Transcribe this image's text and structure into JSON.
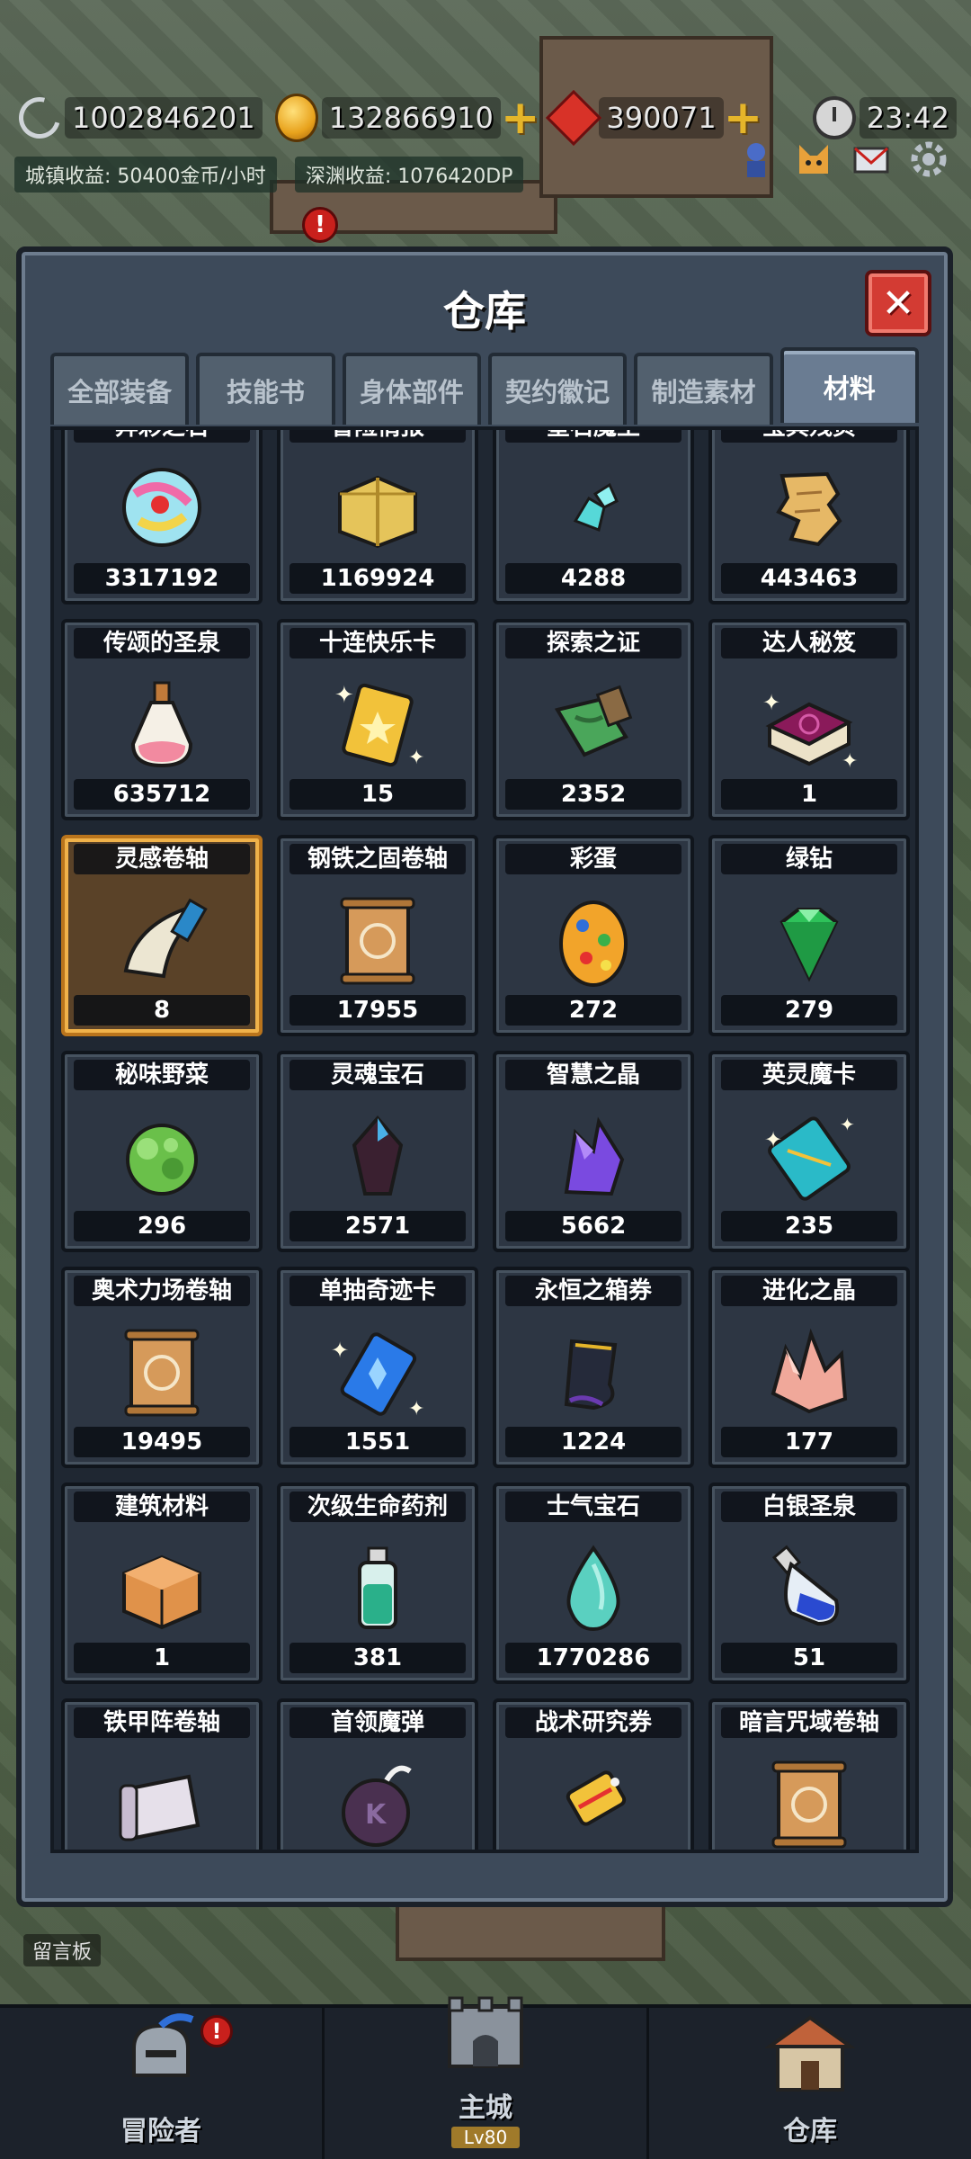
{
  "hud": {
    "moon_value": "1002846201",
    "gold_value": "132866910",
    "gem_value": "390071",
    "time": "23:42",
    "town_income": "城镇收益: 50400金币/小时",
    "abyss_income": "深渊收益: 1076420DP"
  },
  "panel": {
    "title": "仓库",
    "close_label": "✕"
  },
  "tabs": [
    {
      "label": "全部装备",
      "active": false
    },
    {
      "label": "技能书",
      "active": false
    },
    {
      "label": "身体部件",
      "active": false
    },
    {
      "label": "契约徽记",
      "active": false
    },
    {
      "label": "制造素材",
      "active": false
    },
    {
      "label": "材料",
      "active": true
    }
  ],
  "items": [
    {
      "name": "异彩之石",
      "count": "3317192",
      "icon": "rainbow-orb"
    },
    {
      "name": "冒险情报",
      "count": "1169924",
      "icon": "parcel"
    },
    {
      "name": "星石魔土",
      "count": "4288",
      "icon": "cyan-ore"
    },
    {
      "name": "宝典残页",
      "count": "443463",
      "icon": "torn-page"
    },
    {
      "name": "传颂的圣泉",
      "count": "635712",
      "icon": "potion-bottle"
    },
    {
      "name": "十连快乐卡",
      "count": "15",
      "icon": "gold-card"
    },
    {
      "name": "探索之证",
      "count": "2352",
      "icon": "map-scroll"
    },
    {
      "name": "达人秘笈",
      "count": "1",
      "icon": "purple-book"
    },
    {
      "name": "灵感卷轴",
      "count": "8",
      "icon": "horn-scroll",
      "selected": true
    },
    {
      "name": "钢铁之固卷轴",
      "count": "17955",
      "icon": "brown-scroll"
    },
    {
      "name": "彩蛋",
      "count": "272",
      "icon": "easter-egg"
    },
    {
      "name": "绿钻",
      "count": "279",
      "icon": "green-gem"
    },
    {
      "name": "秘味野菜",
      "count": "296",
      "icon": "green-herb"
    },
    {
      "name": "灵魂宝石",
      "count": "2571",
      "icon": "dark-crystal"
    },
    {
      "name": "智慧之晶",
      "count": "5662",
      "icon": "purple-crystal"
    },
    {
      "name": "英灵魔卡",
      "count": "235",
      "icon": "teal-card"
    },
    {
      "name": "奥术力场卷轴",
      "count": "19495",
      "icon": "brown-scroll"
    },
    {
      "name": "单抽奇迹卡",
      "count": "1551",
      "icon": "blue-card"
    },
    {
      "name": "永恒之箱券",
      "count": "1224",
      "icon": "dark-ticket"
    },
    {
      "name": "进化之晶",
      "count": "177",
      "icon": "pink-crystal"
    },
    {
      "name": "建筑材料",
      "count": "1",
      "icon": "brick-block"
    },
    {
      "name": "次级生命药剂",
      "count": "381",
      "icon": "green-vial"
    },
    {
      "name": "士气宝石",
      "count": "1770286",
      "icon": "teal-drop"
    },
    {
      "name": "白银圣泉",
      "count": "51",
      "icon": "blue-flask"
    },
    {
      "name": "铁甲阵卷轴",
      "count": "",
      "icon": "grey-scroll"
    },
    {
      "name": "首领魔弹",
      "count": "",
      "icon": "bomb"
    },
    {
      "name": "战术研究券",
      "count": "",
      "icon": "gold-tag"
    },
    {
      "name": "暗言咒域卷轴",
      "count": "",
      "icon": "brown-scroll"
    }
  ],
  "board_label": "留言板",
  "nav": [
    {
      "label": "冒险者",
      "icon": "knight-helmet-icon",
      "badge": "!"
    },
    {
      "label": "主城",
      "icon": "castle-gate-icon",
      "sub": "Lv80"
    },
    {
      "label": "仓库",
      "icon": "warehouse-icon"
    }
  ],
  "colors": {
    "panel_bg": "#3d4a5a",
    "selected_border": "#f0b24a",
    "close_button": "#d33b33",
    "accent_gold": "#e5b52a"
  }
}
